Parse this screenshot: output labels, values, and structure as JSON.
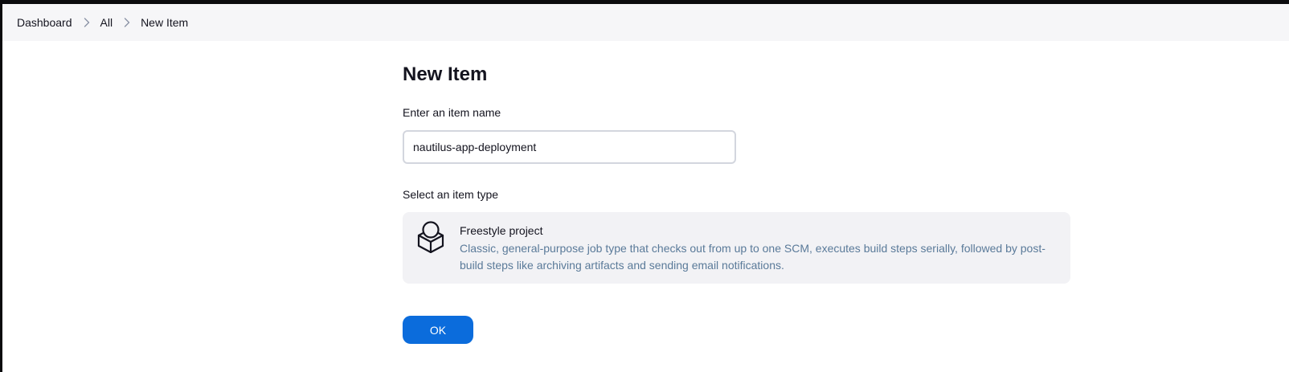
{
  "breadcrumb": {
    "items": [
      {
        "label": "Dashboard"
      },
      {
        "label": "All"
      },
      {
        "label": "New Item"
      }
    ],
    "separator_icon": "chevron-right-icon"
  },
  "page": {
    "title": "New Item"
  },
  "item_name": {
    "label": "Enter an item name",
    "value": "nautilus-app-deployment"
  },
  "item_type": {
    "label": "Select an item type",
    "options": [
      {
        "name": "Freestyle project",
        "description": "Classic, general-purpose job type that checks out from up to one SCM, executes build steps serially, followed by post-build steps like archiving artifacts and sending email notifications.",
        "icon": "freestyle-project-icon"
      }
    ]
  },
  "actions": {
    "ok_label": "OK"
  },
  "colors": {
    "primary_button": "#0b6cdc",
    "description_text": "#5a7a99",
    "card_background": "#f2f2f5",
    "breadcrumb_background": "#f6f6f8"
  }
}
